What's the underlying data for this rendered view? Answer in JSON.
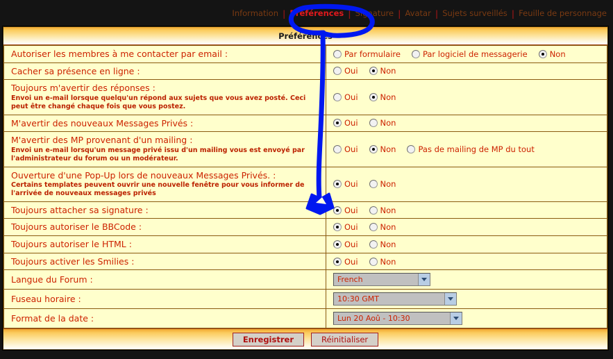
{
  "topnav": {
    "tabs": [
      {
        "label": "Information",
        "active": false
      },
      {
        "label": "Préférences",
        "active": true
      },
      {
        "label": "Signature",
        "active": false
      },
      {
        "label": "Avatar",
        "active": false
      },
      {
        "label": "Sujets surveillés",
        "active": false
      },
      {
        "label": "Feuille de personnage",
        "active": false
      }
    ],
    "separator": "|"
  },
  "panel": {
    "title": "Préférences"
  },
  "rows": [
    {
      "label": "Autoriser les membres à me contacter par email :",
      "desc": "",
      "options": [
        {
          "caption": "Par formulaire",
          "checked": false
        },
        {
          "caption": "Par logiciel de messagerie",
          "checked": false
        },
        {
          "caption": "Non",
          "checked": true
        }
      ]
    },
    {
      "label": "Cacher sa présence en ligne :",
      "desc": "",
      "options": [
        {
          "caption": "Oui",
          "checked": false
        },
        {
          "caption": "Non",
          "checked": true
        }
      ]
    },
    {
      "label": "Toujours m'avertir des réponses :",
      "desc": "Envoi un e-mail lorsque quelqu'un répond aux sujets que vous avez posté. Ceci peut être changé chaque fois que vous postez.",
      "options": [
        {
          "caption": "Oui",
          "checked": false
        },
        {
          "caption": "Non",
          "checked": true
        }
      ]
    },
    {
      "label": "M'avertir des nouveaux Messages Privés :",
      "desc": "",
      "options": [
        {
          "caption": "Oui",
          "checked": true
        },
        {
          "caption": "Non",
          "checked": false
        }
      ]
    },
    {
      "label": "M'avertir des MP provenant d'un mailing :",
      "desc": "Envoi un e-mail lorsqu'un message privé issu d'un mailing vous est envoyé par l'administrateur du forum ou un modérateur.",
      "options": [
        {
          "caption": "Oui",
          "checked": false
        },
        {
          "caption": "Non",
          "checked": true
        },
        {
          "caption": "Pas de mailing de MP du tout",
          "checked": false
        }
      ]
    },
    {
      "label": "Ouverture d'une Pop-Up lors de nouveaux Messages Privés. :",
      "desc": "Certains templates peuvent ouvrir une nouvelle fenêtre pour vous informer de l'arrivée de nouveaux messages privés",
      "options": [
        {
          "caption": "Oui",
          "checked": true
        },
        {
          "caption": "Non",
          "checked": false
        }
      ]
    },
    {
      "label": "Toujours attacher sa signature :",
      "desc": "",
      "options": [
        {
          "caption": "Oui",
          "checked": true
        },
        {
          "caption": "Non",
          "checked": false
        }
      ]
    },
    {
      "label": "Toujours autoriser le BBCode :",
      "desc": "",
      "options": [
        {
          "caption": "Oui",
          "checked": true
        },
        {
          "caption": "Non",
          "checked": false
        }
      ]
    },
    {
      "label": "Toujours autoriser le HTML :",
      "desc": "",
      "options": [
        {
          "caption": "Oui",
          "checked": true
        },
        {
          "caption": "Non",
          "checked": false
        }
      ]
    },
    {
      "label": "Toujours activer les Smilies :",
      "desc": "",
      "options": [
        {
          "caption": "Oui",
          "checked": true
        },
        {
          "caption": "Non",
          "checked": false
        }
      ]
    }
  ],
  "selects": [
    {
      "label": "Langue du Forum :",
      "value": "French",
      "width": "w1"
    },
    {
      "label": "Fuseau horaire :",
      "value": "10:30 GMT",
      "width": "w2"
    },
    {
      "label": "Format de la date :",
      "value": "Lun 20 Aoû - 10:30",
      "width": "w3"
    }
  ],
  "footer": {
    "submit_label": "Enregistrer",
    "reset_label": "Réinitialiser"
  },
  "annotation": {
    "color": "#0018f0",
    "shape": "circle-around-preferences-tab-with-arrow-down"
  }
}
